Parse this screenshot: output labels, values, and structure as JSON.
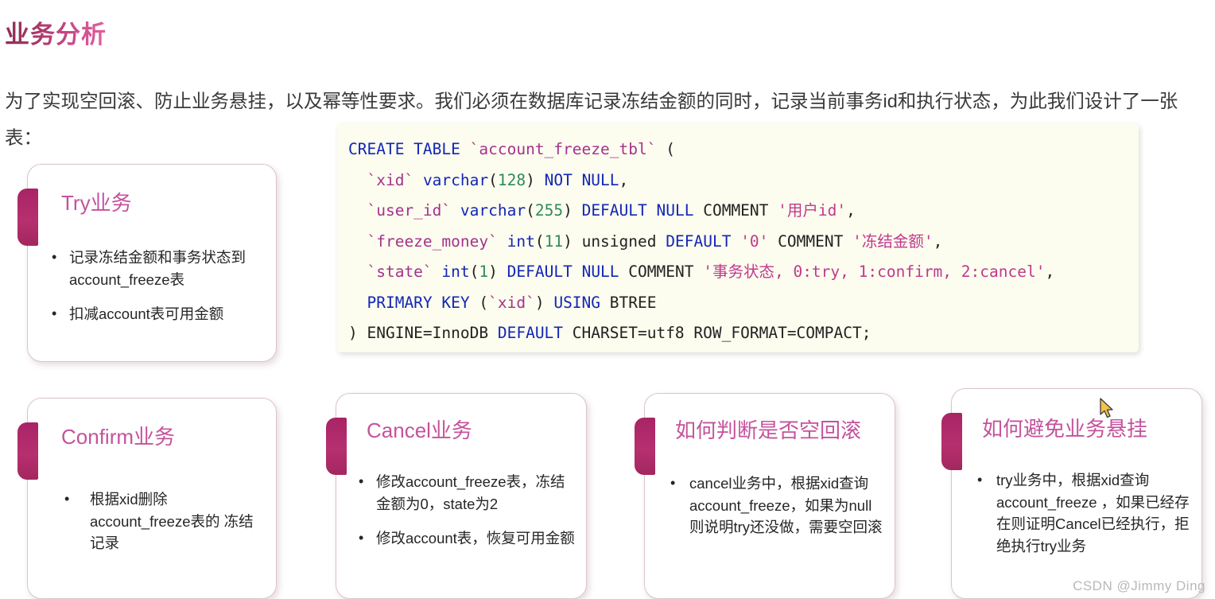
{
  "page_title": "业务分析",
  "intro_paragraph": "为了实现空回滚、防止业务悬挂，以及幂等性要求。我们必须在数据库记录冻结金额的同时，记录当前事务id和执行状态，为此我们设计了一张表：",
  "code_block": {
    "language": "sql",
    "lines": [
      "CREATE TABLE `account_freeze_tbl` (",
      "  `xid` varchar(128) NOT NULL,",
      "  `user_id` varchar(255) DEFAULT NULL COMMENT '用户id',",
      "  `freeze_money` int(11) unsigned DEFAULT '0' COMMENT '冻结金额',",
      "  `state` int(1) DEFAULT NULL COMMENT '事务状态, 0:try, 1:confirm, 2:cancel',",
      "  PRIMARY KEY (`xid`) USING BTREE",
      ") ENGINE=InnoDB DEFAULT CHARSET=utf8 ROW_FORMAT=COMPACT;"
    ],
    "colors": {
      "background": "#fcfcef",
      "keyword": "#1226b5",
      "identifier": "#a3338c",
      "number": "#2e8b57",
      "string": "#c0398c",
      "plain": "#222222"
    }
  },
  "cards": [
    {
      "id": "try",
      "title": "Try业务",
      "bullet_marker": "•",
      "bullets": [
        "记录冻结金额和事务状态到 account_freeze表",
        "扣减account表可用金额"
      ]
    },
    {
      "id": "confirm",
      "title": "Confirm业务",
      "bullet_marker": "•",
      "bullets": [
        "根据xid删除 account_freeze表的 冻结记录"
      ]
    },
    {
      "id": "cancel",
      "title": "Cancel业务",
      "bullet_marker": "•",
      "bullets": [
        "修改account_freeze表，冻结金额为0，state为2",
        "修改account表，恢复可用金额"
      ]
    },
    {
      "id": "empty-rollback",
      "title": "如何判断是否空回滚",
      "bullet_marker": "•",
      "bullets": [
        "cancel业务中，根据xid查询account_freeze，如果为null则说明try还没做，需要空回滚"
      ]
    },
    {
      "id": "avoid-hang",
      "title": "如何避免业务悬挂",
      "bullet_marker": "•",
      "bullets": [
        "try业务中，根据xid查询account_freeze ，如果已经存在则证明Cancel已经执行，拒绝执行try业务"
      ]
    }
  ],
  "watermark": "CSDN @Jimmy Ding",
  "theme": {
    "title_gradient_start": "#8e2c52",
    "title_gradient_end": "#e061a0",
    "card_title_color": "#c4539c",
    "card_tab_color": "#b0296b",
    "card_border_color": "#d9c3cf",
    "cursor_color": "#f3c24a"
  }
}
